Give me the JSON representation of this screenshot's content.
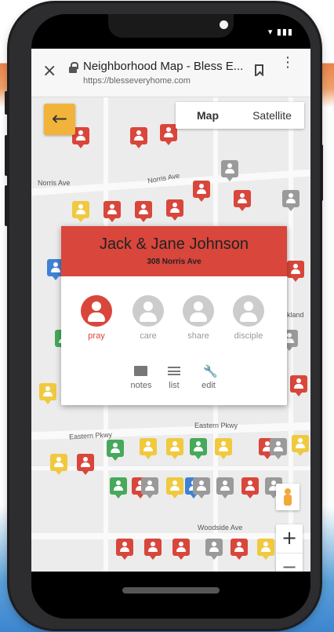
{
  "status": {
    "icons": "▾ ▮▮▮"
  },
  "browser": {
    "close_icon": "×",
    "title": "Neighborhood Map - Bless E...",
    "url": "https://blesseveryhome.com",
    "bookmark_icon": "bookmark-icon",
    "menu_icon": "⋮"
  },
  "map": {
    "back_icon": "←",
    "toggle": {
      "map": "Map",
      "satellite": "Satellite"
    },
    "roads": {
      "norris_1": "Norris Ave",
      "norris_2": "Norris Ave",
      "eastern_1": "Eastern Pkwy",
      "eastern_2": "Eastern Pkwy",
      "woodside": "Woodside Ave",
      "oakland": "kland"
    },
    "colors": {
      "red": "#d9463b",
      "gray": "#9a9a9a",
      "yellow": "#f0c93f",
      "green": "#46a95b",
      "blue": "#3f82d4"
    }
  },
  "popup": {
    "name": "Jack & Jane Johnson",
    "address": "308 Norris Ave",
    "actions": [
      "pray",
      "care",
      "share",
      "disciple"
    ],
    "tools": [
      "notes",
      "list",
      "edit"
    ],
    "edit_icon": "🔧"
  },
  "controls": {
    "zoom_in": "+",
    "zoom_out": "−"
  }
}
